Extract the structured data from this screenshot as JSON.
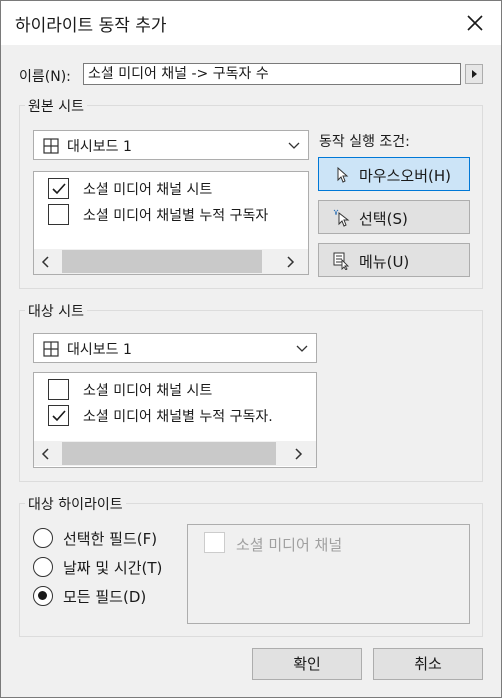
{
  "dialog": {
    "title": "하이라이트 동작 추가"
  },
  "name_field": {
    "label": "이름(N):",
    "value": "소셜 미디어 채널 -> 구독자 수"
  },
  "source": {
    "group_label": "원본 시트",
    "dashboard": "대시보드 1",
    "sheets": [
      {
        "label": "소셜 미디어 채널 시트",
        "checked": true
      },
      {
        "label": "소셜 미디어 채널별 누적 구독자",
        "checked": false
      }
    ]
  },
  "run_condition": {
    "label": "동작 실행 조건:",
    "options": [
      {
        "label": "마우스오버(H)",
        "icon": "pointer-icon",
        "active": true
      },
      {
        "label": "선택(S)",
        "icon": "select-click-icon",
        "active": false
      },
      {
        "label": "메뉴(U)",
        "icon": "menu-icon",
        "active": false
      }
    ]
  },
  "target": {
    "group_label": "대상 시트",
    "dashboard": "대시보드 1",
    "sheets": [
      {
        "label": "소셜 미디어 채널 시트",
        "checked": false
      },
      {
        "label": "소셜 미디어 채널별 누적 구독자.",
        "checked": true
      }
    ]
  },
  "highlight": {
    "group_label": "대상 하이라이트",
    "options": [
      {
        "label": "선택한 필드(F)",
        "selected": false
      },
      {
        "label": "날짜 및 시간(T)",
        "selected": false
      },
      {
        "label": "모든 필드(D)",
        "selected": true
      }
    ],
    "field_list": [
      {
        "label": "소셜 미디어 채널",
        "checked": false,
        "disabled": true
      }
    ]
  },
  "buttons": {
    "ok": "확인",
    "cancel": "취소"
  }
}
